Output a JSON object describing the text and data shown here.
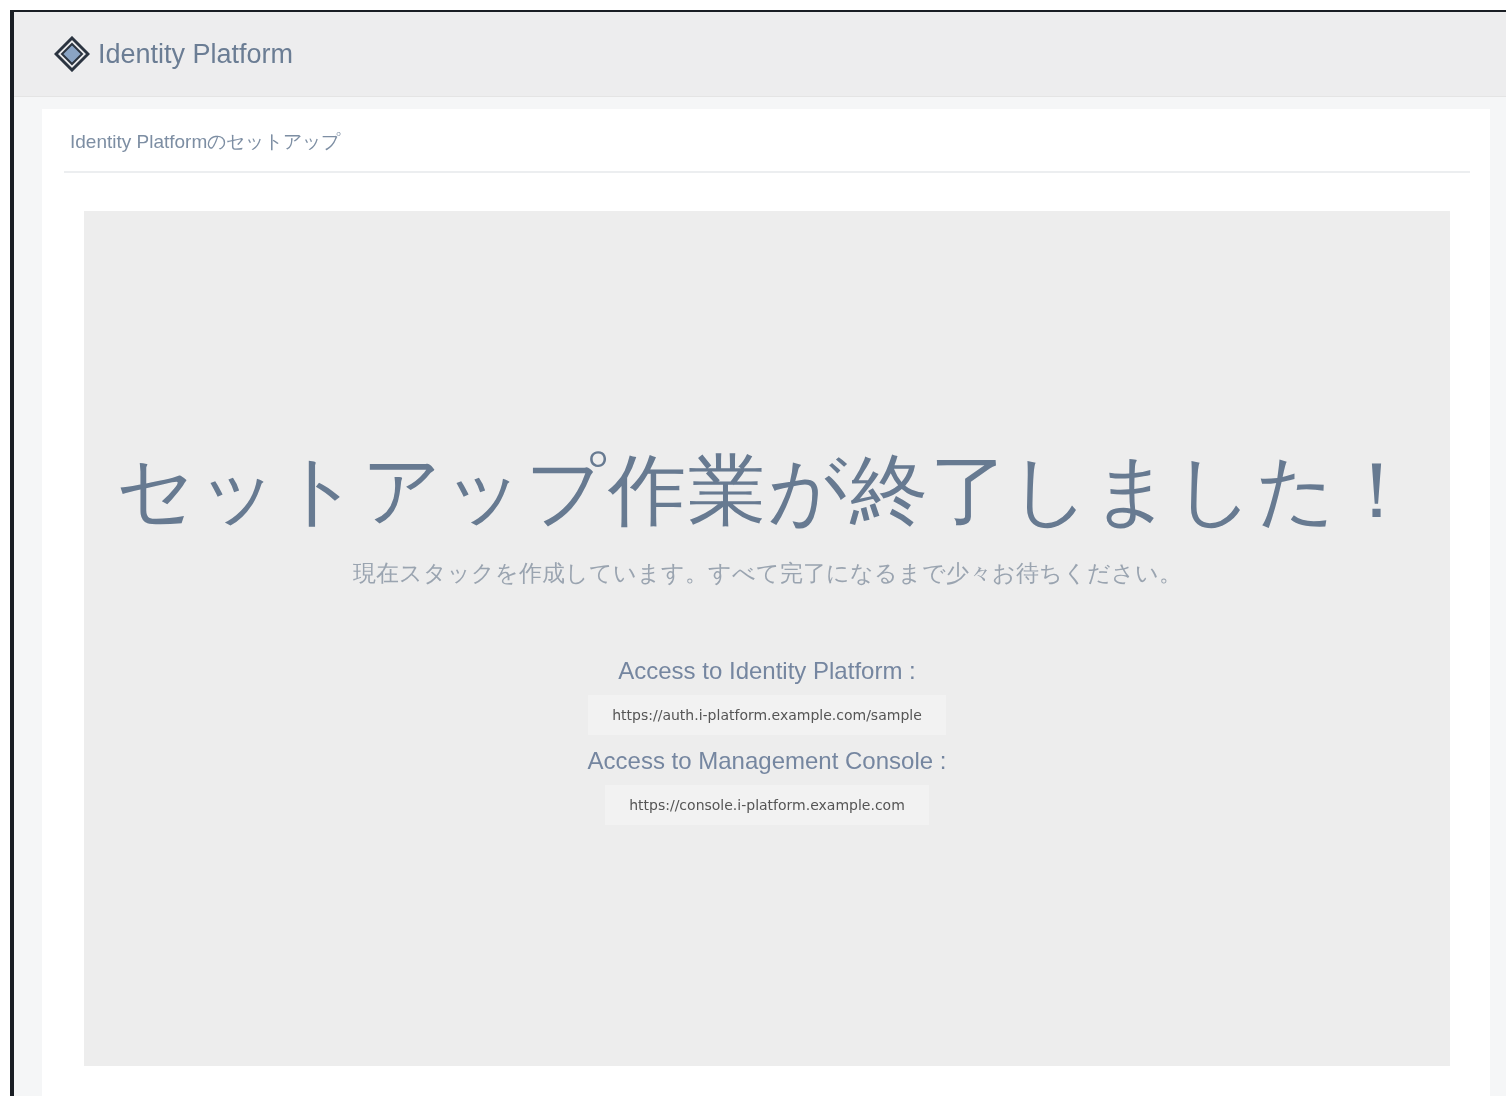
{
  "header": {
    "title": "Identity Platform"
  },
  "card": {
    "title": "Identity Platformのセットアップ"
  },
  "panel": {
    "heading": "セットアップ作業が終了しました！",
    "message": "現在スタックを作成しています。すべて完了になるまで少々お待ちください。",
    "links": [
      {
        "label": "Access to Identity Platform :",
        "url": "https://auth.i-platform.example.com/sample"
      },
      {
        "label": "Access to Management Console :",
        "url": "https://console.i-platform.example.com"
      }
    ]
  }
}
